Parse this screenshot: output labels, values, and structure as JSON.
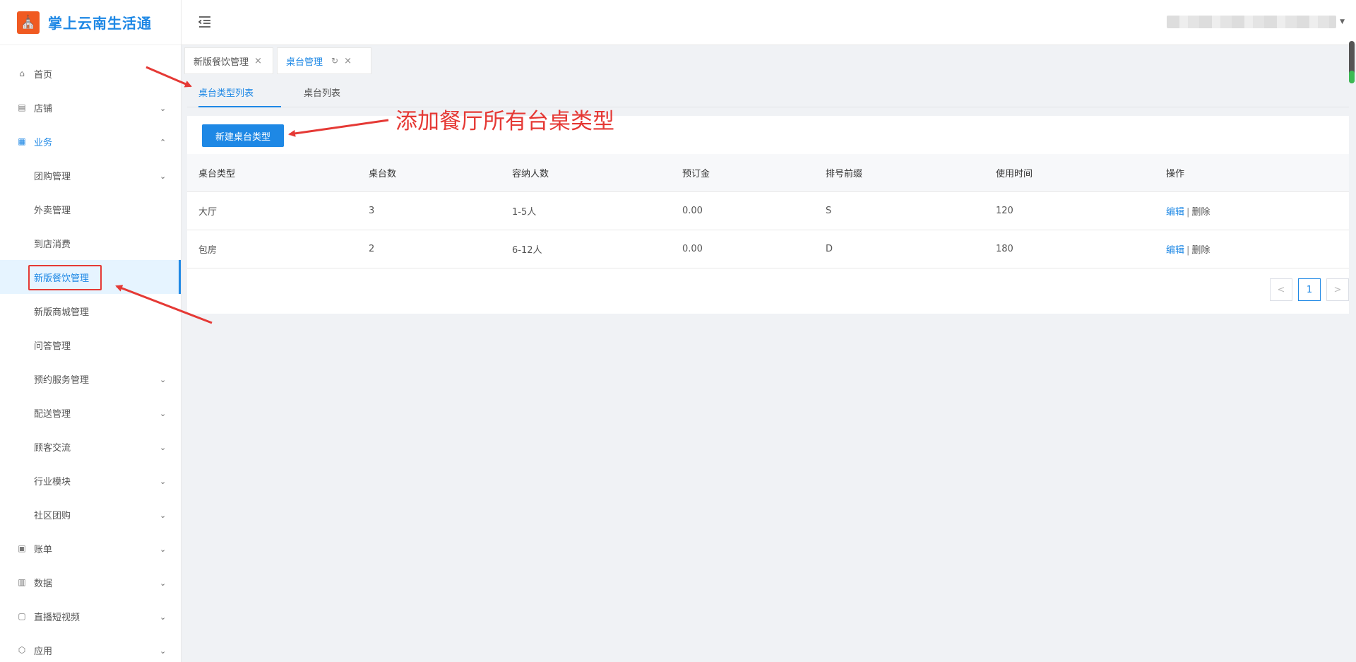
{
  "app": {
    "logo_glyph": "⛪",
    "name": "掌上云南生活通",
    "brand_color": "#1e88e5",
    "logo_color": "#f05a22"
  },
  "sidebar": {
    "items": [
      {
        "label": "首页",
        "icon": "home-icon",
        "glyph": "⌂"
      },
      {
        "label": "店铺",
        "icon": "store-icon",
        "glyph": "▤"
      },
      {
        "label": "业务",
        "icon": "business-icon",
        "glyph": "▦"
      },
      {
        "label": "团购管理"
      },
      {
        "label": "外卖管理"
      },
      {
        "label": "到店消费"
      },
      {
        "label": "新版餐饮管理"
      },
      {
        "label": "新版商城管理"
      },
      {
        "label": "问答管理"
      },
      {
        "label": "预约服务管理"
      },
      {
        "label": "配送管理"
      },
      {
        "label": "顾客交流"
      },
      {
        "label": "行业模块"
      },
      {
        "label": "社区团购"
      },
      {
        "label": "账单",
        "icon": "bill-icon",
        "glyph": "▣"
      },
      {
        "label": "数据",
        "icon": "data-icon",
        "glyph": "▥"
      },
      {
        "label": "直播短视频",
        "icon": "live-video-icon",
        "glyph": "▢"
      },
      {
        "label": "应用",
        "icon": "app-icon",
        "glyph": "⬡"
      }
    ]
  },
  "tabs": [
    {
      "label": "新版餐饮管理"
    },
    {
      "label": "桌台管理"
    }
  ],
  "subtabs": [
    {
      "label": "桌台类型列表"
    },
    {
      "label": "桌台列表"
    }
  ],
  "toolbar": {
    "new_label": "新建桌台类型"
  },
  "table": {
    "headers": [
      "桌台类型",
      "桌台数",
      "容纳人数",
      "预订金",
      "排号前缀",
      "使用时间",
      "操作"
    ],
    "rows": [
      {
        "type": "大厅",
        "count": "3",
        "capacity": "1-5人",
        "deposit": "0.00",
        "prefix": "S",
        "time": "120",
        "edit": "编辑",
        "sep": "|",
        "delete": "删除"
      },
      {
        "type": "包房",
        "count": "2",
        "capacity": "6-12人",
        "deposit": "0.00",
        "prefix": "D",
        "time": "180",
        "edit": "编辑",
        "sep": "|",
        "delete": "删除"
      }
    ]
  },
  "pagination": {
    "prev": "<",
    "current": "1",
    "next": ">"
  },
  "annotation": {
    "text": "添加餐厅所有台桌类型",
    "color": "#e53935"
  }
}
